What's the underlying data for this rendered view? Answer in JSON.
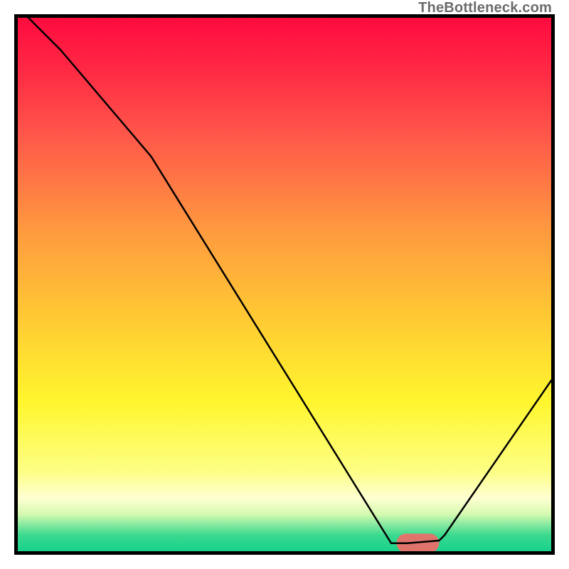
{
  "watermark": "TheBottleneck.com",
  "chart_data": {
    "type": "line",
    "title": "",
    "xlabel": "",
    "ylabel": "",
    "xlim": [
      0,
      100
    ],
    "ylim": [
      0,
      100
    ],
    "grid": false,
    "series": [
      {
        "name": "bottleneck-curve",
        "x": [
          0,
          8,
          25,
          70,
          73,
          79,
          80,
          100
        ],
        "values": [
          102,
          94,
          74,
          1.5,
          1.5,
          2,
          3,
          32
        ],
        "color": "#000000",
        "stroke_width": 2.5
      }
    ],
    "marker": {
      "x_start": 71,
      "x_end": 79,
      "y": 1.5,
      "color": "#e0746c",
      "radius": 1.8
    },
    "background_gradient_stops": [
      {
        "offset": 0,
        "color": "#ff0b3f"
      },
      {
        "offset": 10,
        "color": "#ff2a44"
      },
      {
        "offset": 22,
        "color": "#ff574a"
      },
      {
        "offset": 40,
        "color": "#ff9a3f"
      },
      {
        "offset": 55,
        "color": "#ffc634"
      },
      {
        "offset": 72,
        "color": "#fff62e"
      },
      {
        "offset": 85,
        "color": "#fdff84"
      },
      {
        "offset": 90,
        "color": "#ffffd2"
      },
      {
        "offset": 93,
        "color": "#d7fab1"
      },
      {
        "offset": 95,
        "color": "#88e9a0"
      },
      {
        "offset": 97,
        "color": "#3ad98f"
      },
      {
        "offset": 100,
        "color": "#17d18b"
      }
    ]
  }
}
